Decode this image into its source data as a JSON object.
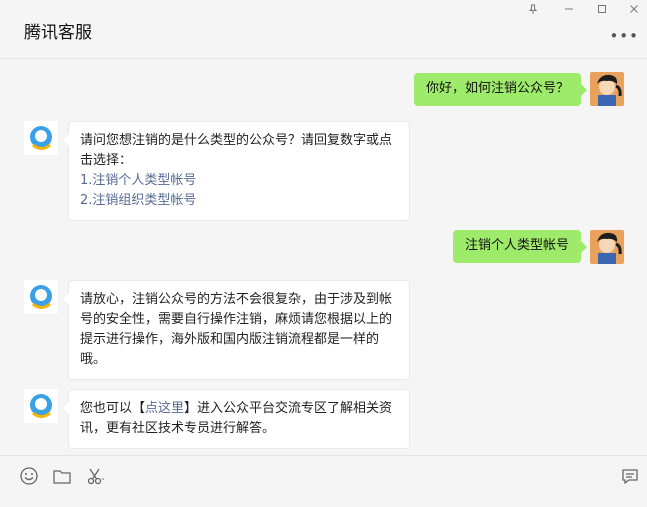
{
  "window": {
    "title": "腾讯客服",
    "controls": {
      "pin": "pin-icon",
      "minimize": "minimize-icon",
      "maximize": "maximize-icon",
      "close": "close-icon"
    },
    "more_icon": "more-icon"
  },
  "colors": {
    "user_bubble": "#9eea6a",
    "bot_bubble": "#ffffff",
    "link": "#576b95",
    "background": "#f5f5f5"
  },
  "messages": [
    {
      "from": "user",
      "text": "你好，如何注销公众号？"
    },
    {
      "from": "bot",
      "text": "请问您想注销的是什么类型的公众号？请回复数字或点击选择：",
      "options": [
        "1.注销个人类型帐号",
        "2.注销组织类型帐号"
      ]
    },
    {
      "from": "user",
      "text": "注销个人类型帐号"
    },
    {
      "from": "bot",
      "text": "请放心，注销公众号的方法不会很复杂，由于涉及到帐号的安全性，需要自行操作注销，麻烦请您根据以上的提示进行操作，海外版和国内版注销流程都是一样的哦。"
    },
    {
      "from": "bot",
      "before": "您也可以【",
      "link": "点这里",
      "after": "】进入公众平台交流专区了解相关资讯，更有社区技术专员进行解答。"
    }
  ],
  "toolbar": {
    "items": [
      "emoji-icon",
      "folder-icon",
      "scissors-icon",
      "chat-bubble-icon"
    ]
  }
}
